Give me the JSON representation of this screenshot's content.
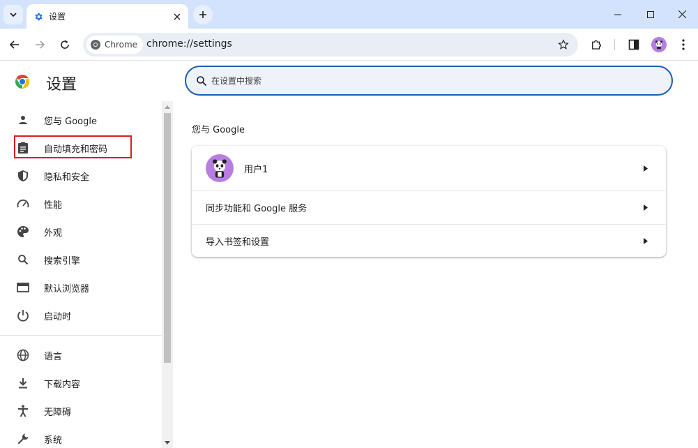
{
  "window": {
    "tab_title": "设置",
    "url": "chrome://settings",
    "chip_label": "Chrome"
  },
  "page": {
    "title": "设置",
    "search_placeholder": "在设置中搜索"
  },
  "sidebar": {
    "items": [
      {
        "label": "您与 Google",
        "icon": "person-icon"
      },
      {
        "label": "自动填充和密码",
        "icon": "clipboard-icon"
      },
      {
        "label": "隐私和安全",
        "icon": "shield-icon"
      },
      {
        "label": "性能",
        "icon": "speedometer-icon"
      },
      {
        "label": "外观",
        "icon": "palette-icon"
      },
      {
        "label": "搜索引擎",
        "icon": "search-icon"
      },
      {
        "label": "默认浏览器",
        "icon": "browser-icon"
      },
      {
        "label": "启动时",
        "icon": "power-icon"
      },
      {
        "label": "语言",
        "icon": "globe-icon"
      },
      {
        "label": "下载内容",
        "icon": "download-icon"
      },
      {
        "label": "无障碍",
        "icon": "accessibility-icon"
      },
      {
        "label": "系统",
        "icon": "wrench-icon"
      }
    ],
    "highlighted_item": "自动填充和密码"
  },
  "main": {
    "section_title": "您与 Google",
    "rows": [
      {
        "label": "用户1"
      },
      {
        "label": "同步功能和 Google 服务"
      },
      {
        "label": "导入书签和设置"
      }
    ]
  },
  "colors": {
    "tabstrip": "#d3e3fd",
    "accent": "#1a5fb4",
    "highlight_border": "#d61f26",
    "avatar": "#b77ee0"
  }
}
